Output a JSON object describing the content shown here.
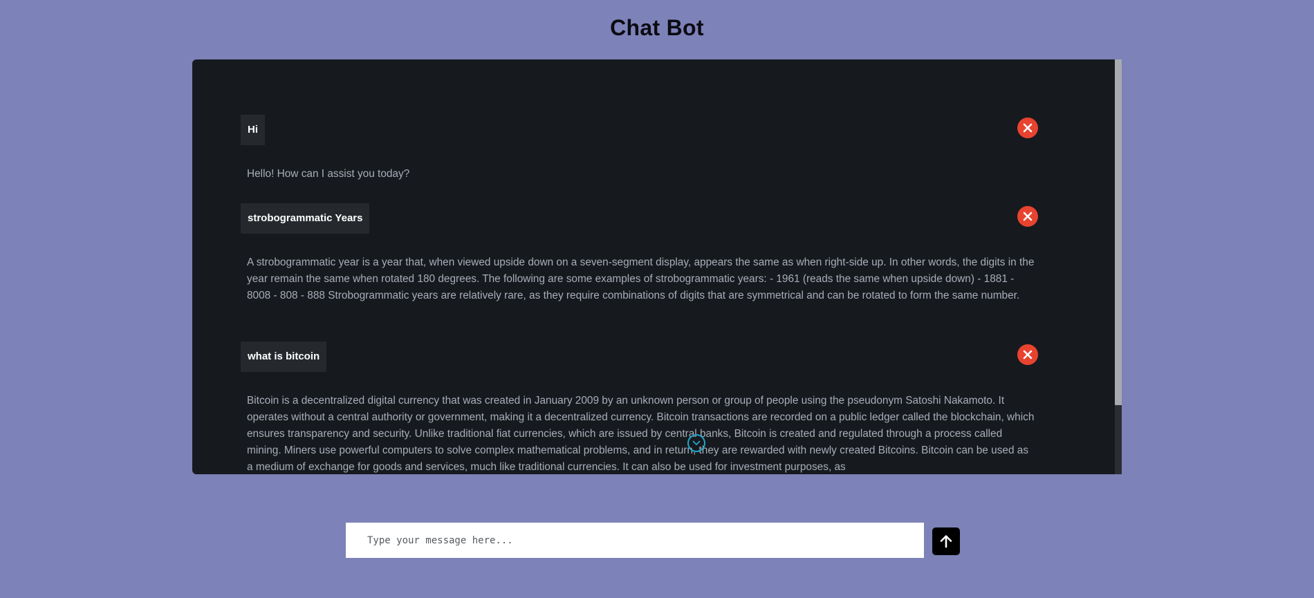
{
  "header": {
    "title": "Chat Bot"
  },
  "conversation": [
    {
      "user": "Hi",
      "bot": "Hello! How can I assist you today?"
    },
    {
      "user": "strobogrammatic Years",
      "bot": "A strobogrammatic year is a year that, when viewed upside down on a seven-segment display, appears the same as when right-side up. In other words, the digits in the year remain the same when rotated 180 degrees. The following are some examples of strobogrammatic years: - 1961 (reads the same when upside down) - 1881 - 8008 - 808 - 888 Strobogrammatic years are relatively rare, as they require combinations of digits that are symmetrical and can be rotated to form the same number."
    },
    {
      "user": "what is bitcoin",
      "bot": "Bitcoin is a decentralized digital currency that was created in January 2009 by an unknown person or group of people using the pseudonym Satoshi Nakamoto. It operates without a central authority or government, making it a decentralized currency. Bitcoin transactions are recorded on a public ledger called the blockchain, which ensures transparency and security. Unlike traditional fiat currencies, which are issued by central banks, Bitcoin is created and regulated through a process called mining. Miners use powerful computers to solve complex mathematical problems, and in return, they are rewarded with newly created Bitcoins. Bitcoin can be used as a medium of exchange for goods and services, much like traditional currencies. It can also be used for investment purposes, as"
    }
  ],
  "icons": {
    "delete": "close-icon",
    "scroll_down": "chevron-down-circle-icon",
    "send": "arrow-up-icon"
  },
  "composer": {
    "placeholder": "Type your message here...",
    "value": ""
  },
  "colors": {
    "background": "#7d82b8",
    "panel": "#161a1f",
    "delete_button": "#e8432f",
    "scroll_down_accent": "#21a7c9",
    "send_button": "#000000"
  }
}
